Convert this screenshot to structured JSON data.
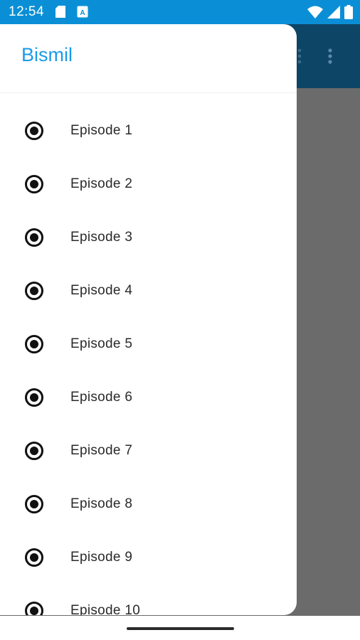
{
  "status_bar": {
    "time": "12:54",
    "background": "#0a8fd6",
    "icons": [
      "sd-card-icon",
      "a-notification-icon",
      "wifi-icon",
      "signal-icon",
      "battery-icon"
    ]
  },
  "drawer": {
    "title": "Bismil",
    "title_color": "#1a9be8",
    "items": [
      {
        "label": "Episode 1",
        "icon": "radio-selected-icon"
      },
      {
        "label": "Episode 2",
        "icon": "radio-selected-icon"
      },
      {
        "label": "Episode 3",
        "icon": "radio-selected-icon"
      },
      {
        "label": "Episode 4",
        "icon": "radio-selected-icon"
      },
      {
        "label": "Episode 5",
        "icon": "radio-selected-icon"
      },
      {
        "label": "Episode 6",
        "icon": "radio-selected-icon"
      },
      {
        "label": "Episode 7",
        "icon": "radio-selected-icon"
      },
      {
        "label": "Episode 8",
        "icon": "radio-selected-icon"
      },
      {
        "label": "Episode 9",
        "icon": "radio-selected-icon"
      },
      {
        "label": "Episode 10",
        "icon": "radio-selected-icon"
      }
    ]
  },
  "app": {
    "toolbar_color": "#0d4566",
    "scrim_color": "#6b6b6b",
    "toolbar_icons": [
      "more-vert-icon"
    ]
  }
}
